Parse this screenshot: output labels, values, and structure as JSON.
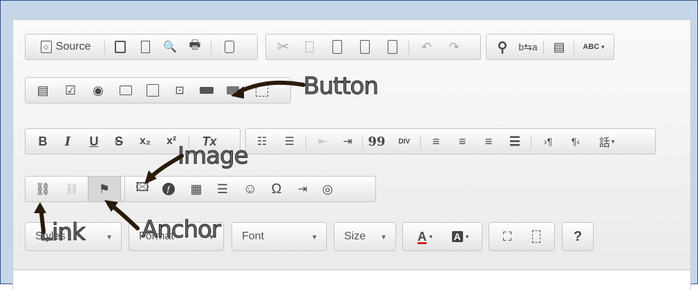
{
  "toolbar": {
    "source_label": "Source",
    "cut_icon": "✂",
    "bold": "B",
    "italic": "I",
    "underline": "U",
    "strike": "S",
    "subscript": "x₂",
    "superscript": "x²",
    "remove_format": "Tx",
    "blockquote": "99",
    "div": "DIV",
    "spell": "ABC",
    "omega": "Ω",
    "smiley": "☺",
    "help": "?"
  },
  "combos": {
    "styles": "Styles",
    "format": "Format",
    "font": "Font",
    "size": "Size"
  },
  "colors": {
    "text_color": "A",
    "bg_color": "A"
  },
  "annotations": {
    "button": "Button",
    "image": "Image",
    "link": "Link",
    "anchor": "Anchor"
  }
}
